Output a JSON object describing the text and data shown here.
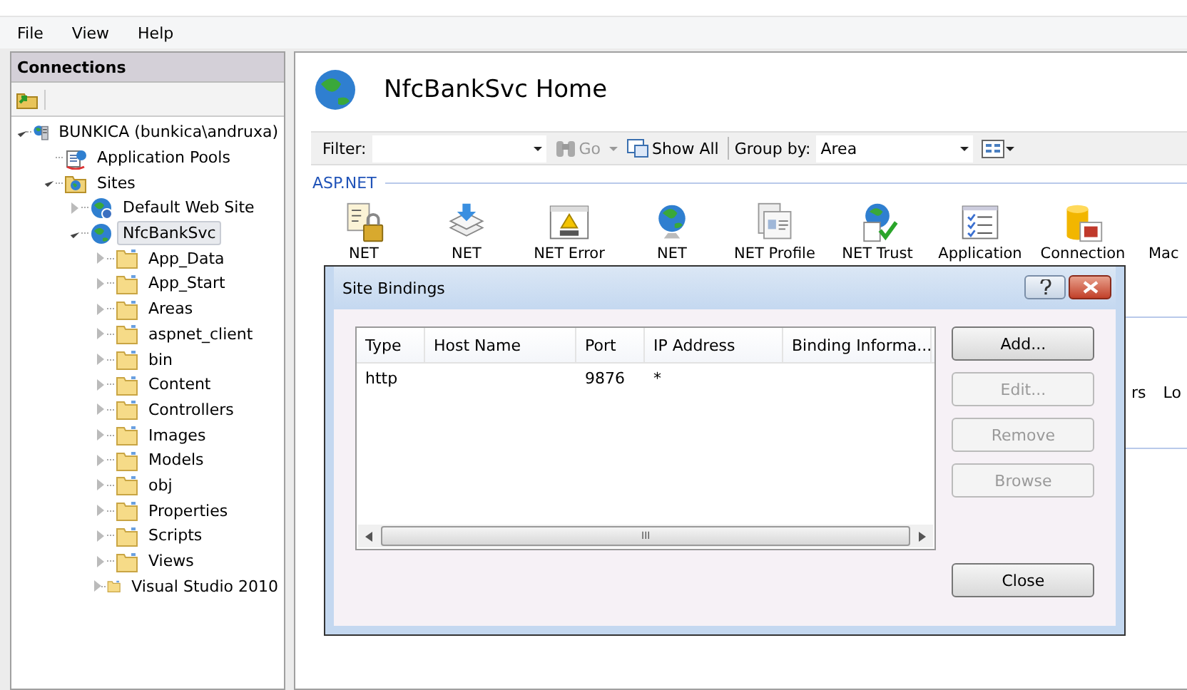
{
  "menu": [
    "File",
    "View",
    "Help"
  ],
  "connections": {
    "title": "Connections",
    "tree": [
      {
        "label": "BUNKICA (bunkica\\andruxa)",
        "kind": "server",
        "expanded": true,
        "selected": false,
        "children": [
          {
            "label": "Application Pools",
            "kind": "pools",
            "selected": false
          },
          {
            "label": "Sites",
            "kind": "sites",
            "expanded": true,
            "selected": false,
            "children": [
              {
                "label": "Default Web Site",
                "kind": "site_default",
                "expanded": false,
                "selected": false
              },
              {
                "label": "NfcBankSvc",
                "kind": "site",
                "expanded": true,
                "selected": true,
                "children": [
                  {
                    "label": "App_Data",
                    "kind": "folder",
                    "expanded": false,
                    "selected": false
                  },
                  {
                    "label": "App_Start",
                    "kind": "folder",
                    "expanded": false,
                    "selected": false
                  },
                  {
                    "label": "Areas",
                    "kind": "folder",
                    "expanded": false,
                    "selected": false
                  },
                  {
                    "label": "aspnet_client",
                    "kind": "folder",
                    "expanded": false,
                    "selected": false
                  },
                  {
                    "label": "bin",
                    "kind": "folder",
                    "expanded": false,
                    "selected": false
                  },
                  {
                    "label": "Content",
                    "kind": "folder",
                    "expanded": false,
                    "selected": false
                  },
                  {
                    "label": "Controllers",
                    "kind": "folder",
                    "expanded": false,
                    "selected": false
                  },
                  {
                    "label": "Images",
                    "kind": "folder",
                    "expanded": false,
                    "selected": false
                  },
                  {
                    "label": "Models",
                    "kind": "folder",
                    "expanded": false,
                    "selected": false
                  },
                  {
                    "label": "obj",
                    "kind": "folder",
                    "expanded": false,
                    "selected": false
                  },
                  {
                    "label": "Properties",
                    "kind": "folder",
                    "expanded": false,
                    "selected": false
                  },
                  {
                    "label": "Scripts",
                    "kind": "folder",
                    "expanded": false,
                    "selected": false
                  },
                  {
                    "label": "Views",
                    "kind": "folder",
                    "expanded": false,
                    "selected": false
                  },
                  {
                    "label": "Visual Studio 2010",
                    "kind": "folder",
                    "expanded": false,
                    "selected": false
                  }
                ]
              }
            ]
          }
        ]
      }
    ]
  },
  "home": {
    "title": "NfcBankSvc Home",
    "filter_label": "Filter:",
    "go": "Go",
    "show_all": "Show All",
    "group_by_label": "Group by:",
    "group_by": "Area",
    "section": "ASP.NET",
    "features": [
      {
        "label": "NET",
        "kind": "lock"
      },
      {
        "label": "NET",
        "kind": "stack"
      },
      {
        "label": "NET Error",
        "kind": "error"
      },
      {
        "label": "NET",
        "kind": "globe"
      },
      {
        "label": "NET Profile",
        "kind": "profile"
      },
      {
        "label": "NET Trust",
        "kind": "trust"
      },
      {
        "label": "Application",
        "kind": "list"
      },
      {
        "label": "Connection",
        "kind": "db"
      },
      {
        "label": "Mac",
        "kind": "none"
      }
    ],
    "second_row": [
      "rs",
      "Lo"
    ]
  },
  "dialog": {
    "title": "Site Bindings",
    "columns": [
      "Type",
      "Host Name",
      "Port",
      "IP Address",
      "Binding Informa..."
    ],
    "rows": [
      [
        "http",
        "",
        "9876",
        "*",
        ""
      ]
    ],
    "buttons": [
      {
        "label": "Add...",
        "disabled": false
      },
      {
        "label": "Edit...",
        "disabled": true
      },
      {
        "label": "Remove",
        "disabled": true
      },
      {
        "label": "Browse",
        "disabled": true
      }
    ],
    "close": "Close",
    "scroll_grip": "III"
  }
}
